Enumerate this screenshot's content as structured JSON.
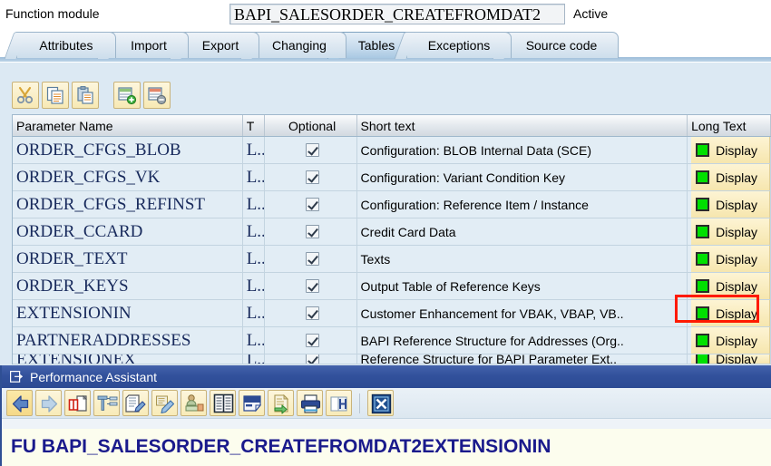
{
  "header": {
    "label": "Function module",
    "function_module_name": "BAPI_SALESORDER_CREATEFROMDAT2",
    "status": "Active"
  },
  "tabs": [
    {
      "label": "Attributes",
      "active": false
    },
    {
      "label": "Import",
      "active": false
    },
    {
      "label": "Export",
      "active": false
    },
    {
      "label": "Changing",
      "active": false
    },
    {
      "label": "Tables",
      "active": true
    },
    {
      "label": "Exceptions",
      "active": false
    },
    {
      "label": "Source code",
      "active": false
    }
  ],
  "toolbar": [
    {
      "name": "cut-icon",
      "title": "Cut"
    },
    {
      "name": "copy-icon",
      "title": "Copy"
    },
    {
      "name": "paste-icon",
      "title": "Paste"
    },
    {
      "name": "insert-row-icon",
      "title": "Insert Row"
    },
    {
      "name": "delete-row-icon",
      "title": "Delete Row"
    }
  ],
  "table": {
    "columns": [
      "Parameter Name",
      "T",
      "Optional",
      "Short text",
      "Long Text"
    ],
    "long_text_button_label": "Display",
    "rows": [
      {
        "name": "ORDER_CFGS_BLOB",
        "type": "L..",
        "optional": true,
        "short_text": "Configuration: BLOB Internal Data (SCE)",
        "long_text": "Display",
        "highlighted": false
      },
      {
        "name": "ORDER_CFGS_VK",
        "type": "L..",
        "optional": true,
        "short_text": "Configuration: Variant Condition Key",
        "long_text": "Display",
        "highlighted": false
      },
      {
        "name": "ORDER_CFGS_REFINST",
        "type": "L..",
        "optional": true,
        "short_text": "Configuration: Reference Item / Instance",
        "long_text": "Display",
        "highlighted": false
      },
      {
        "name": "ORDER_CCARD",
        "type": "L..",
        "optional": true,
        "short_text": "Credit Card Data",
        "long_text": "Display",
        "highlighted": false
      },
      {
        "name": "ORDER_TEXT",
        "type": "L..",
        "optional": true,
        "short_text": "Texts",
        "long_text": "Display",
        "highlighted": false
      },
      {
        "name": "ORDER_KEYS",
        "type": "L..",
        "optional": true,
        "short_text": "Output Table of Reference Keys",
        "long_text": "Display",
        "highlighted": false
      },
      {
        "name": "EXTENSIONIN",
        "type": "L..",
        "optional": true,
        "short_text": "Customer Enhancement for VBAK, VBAP, VB..",
        "long_text": "Display",
        "highlighted": true
      },
      {
        "name": "PARTNERADDRESSES",
        "type": "L..",
        "optional": true,
        "short_text": "BAPI Reference Structure for Addresses (Org..",
        "long_text": "Display",
        "highlighted": false
      },
      {
        "name": "EXTENSIONEX",
        "type": "L..",
        "optional": true,
        "short_text": "Reference Structure for BAPI Parameter Ext..",
        "long_text": "Display",
        "highlighted": false
      }
    ]
  },
  "performance_assistant": {
    "window_title": "Performance Assistant",
    "heading": "FU BAPI_SALESORDER_CREATEFROMDAT2EXTENSIONIN",
    "grip": "▪▪▪▪▪",
    "toolbar": [
      {
        "name": "back-arrow-icon",
        "title": "Back"
      },
      {
        "name": "forward-arrow-icon",
        "title": "Forward"
      },
      {
        "name": "open-book-icon",
        "title": "Documentation"
      },
      {
        "name": "technical-info-icon",
        "title": "Technical Information"
      },
      {
        "name": "edit-document-icon",
        "title": "Edit"
      },
      {
        "name": "edit-pencil-icon",
        "title": "Change"
      },
      {
        "name": "personal-note-icon",
        "title": "Personal Note"
      },
      {
        "name": "glossary-book-icon",
        "title": "Glossary"
      },
      {
        "name": "extended-help-icon",
        "title": "Extended Help"
      },
      {
        "name": "export-document-icon",
        "title": "Export"
      },
      {
        "name": "print-icon",
        "title": "Print"
      },
      {
        "name": "search-document-icon",
        "title": "Find"
      },
      {
        "name": "close-window-icon",
        "title": "Close"
      }
    ]
  },
  "colors": {
    "accent_blue": "#2c4a93",
    "panel_bg": "#dce9f3",
    "row_bg": "#e2edf5",
    "button_yellow": "#f6e6ae",
    "status_green": "#00e000",
    "highlight_red": "#ff1a00",
    "heading_navy": "#1a1a8c",
    "param_navy": "#182a5c"
  }
}
